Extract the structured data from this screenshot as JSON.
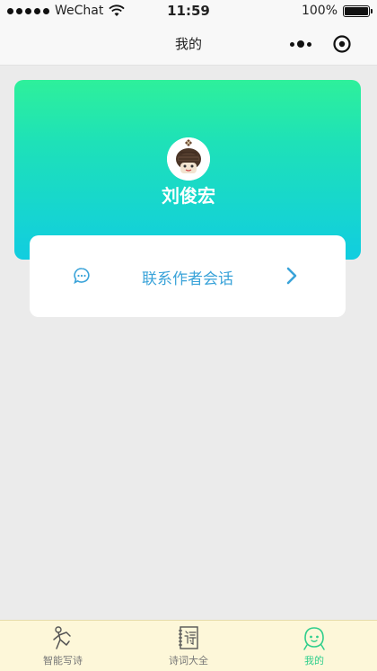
{
  "status_bar": {
    "carrier": "WeChat",
    "time": "11:59",
    "battery": "100%"
  },
  "navbar": {
    "title": "我的"
  },
  "profile": {
    "username": "刘俊宏"
  },
  "contact": {
    "label": "联系作者会话"
  },
  "tabbar": {
    "tabs": [
      {
        "label": "智能写诗",
        "icon": "running-figure-icon",
        "active": false
      },
      {
        "label": "诗词大全",
        "icon": "poem-book-icon",
        "active": false
      },
      {
        "label": "我的",
        "icon": "profile-face-icon",
        "active": true
      }
    ]
  },
  "colors": {
    "card_gradient_top": "#2ef09b",
    "card_gradient_bottom": "#11cde0",
    "contact_text": "#3aa3d9",
    "tab_active": "#2fce8c",
    "tabbar_bg": "#fdf7d9"
  }
}
